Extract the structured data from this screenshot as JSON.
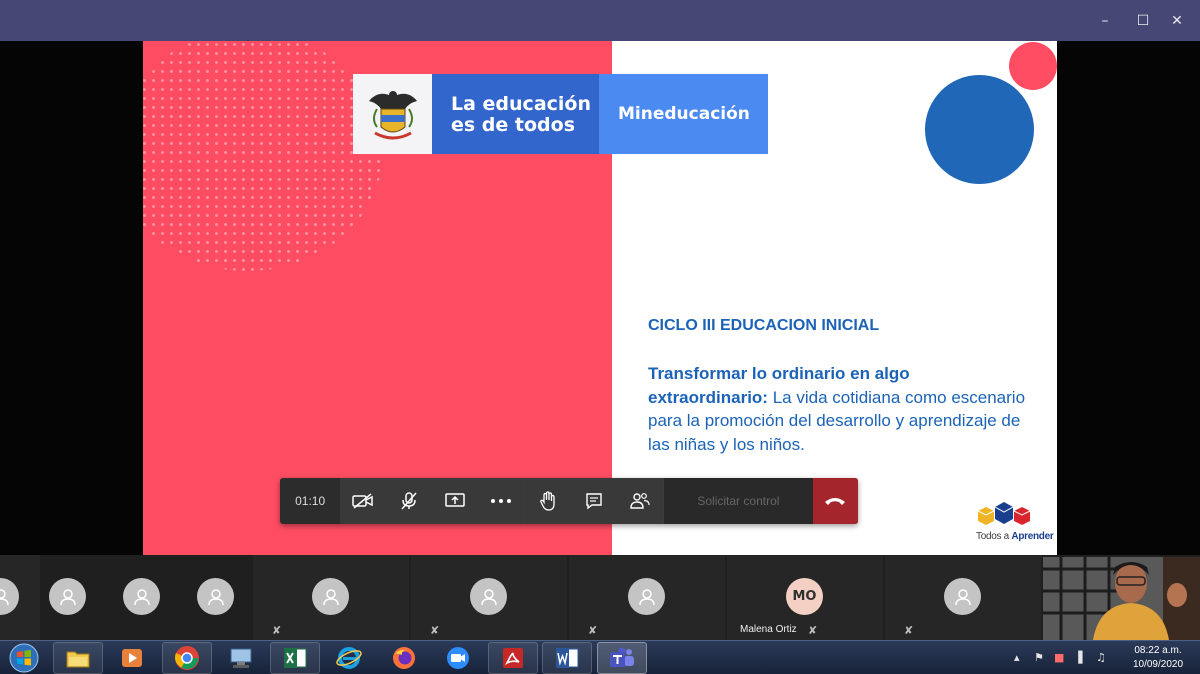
{
  "window": {
    "controls": {
      "minimize": "–",
      "maximize": "☐",
      "close": "✕"
    }
  },
  "slide": {
    "banner": {
      "line1": "La educación",
      "line2": "es de todos",
      "ministry": "Mineducación"
    },
    "heading": "CICLO III EDUCACION INICIAL",
    "body_bold": "Transformar lo ordinario en algo extraordinario:",
    "body_rest": " La vida cotidiana como escenario para la promoción del desarrollo y aprendizaje de las niñas y los niños.",
    "logo": {
      "prefix": "Todos a ",
      "name": "Aprender"
    },
    "colors": {
      "pink": "#fe4d63",
      "blue": "#2167b8",
      "text_blue": "#1c63b8"
    }
  },
  "meeting_controls": {
    "timer": "01:10",
    "request_control": "Solicitar control",
    "icons": [
      "video-off-icon",
      "mic-off-icon",
      "share-screen-icon",
      "more-icon",
      "raise-hand-icon",
      "chat-icon",
      "participants-icon",
      "hang-up-icon"
    ]
  },
  "participants": [
    {
      "initials": "",
      "name": ""
    },
    {
      "initials": "",
      "name": ""
    },
    {
      "initials": "",
      "name": ""
    },
    {
      "initials": "",
      "name": ""
    },
    {
      "initials": "",
      "name": ""
    },
    {
      "initials": "",
      "name": ""
    },
    {
      "initials": "",
      "name": ""
    },
    {
      "initials": "MO",
      "name": "Malena Ortiz"
    },
    {
      "initials": "",
      "name": ""
    }
  ],
  "taskbar": {
    "apps": [
      "explorer-icon",
      "media-player-icon",
      "chrome-icon",
      "network-icon",
      "excel-icon",
      "ie-icon",
      "firefox-icon",
      "zoom-icon",
      "acrobat-icon",
      "word-icon",
      "teams-icon"
    ],
    "clock_time": "08:22 a.m.",
    "clock_date": "10/09/2020"
  }
}
